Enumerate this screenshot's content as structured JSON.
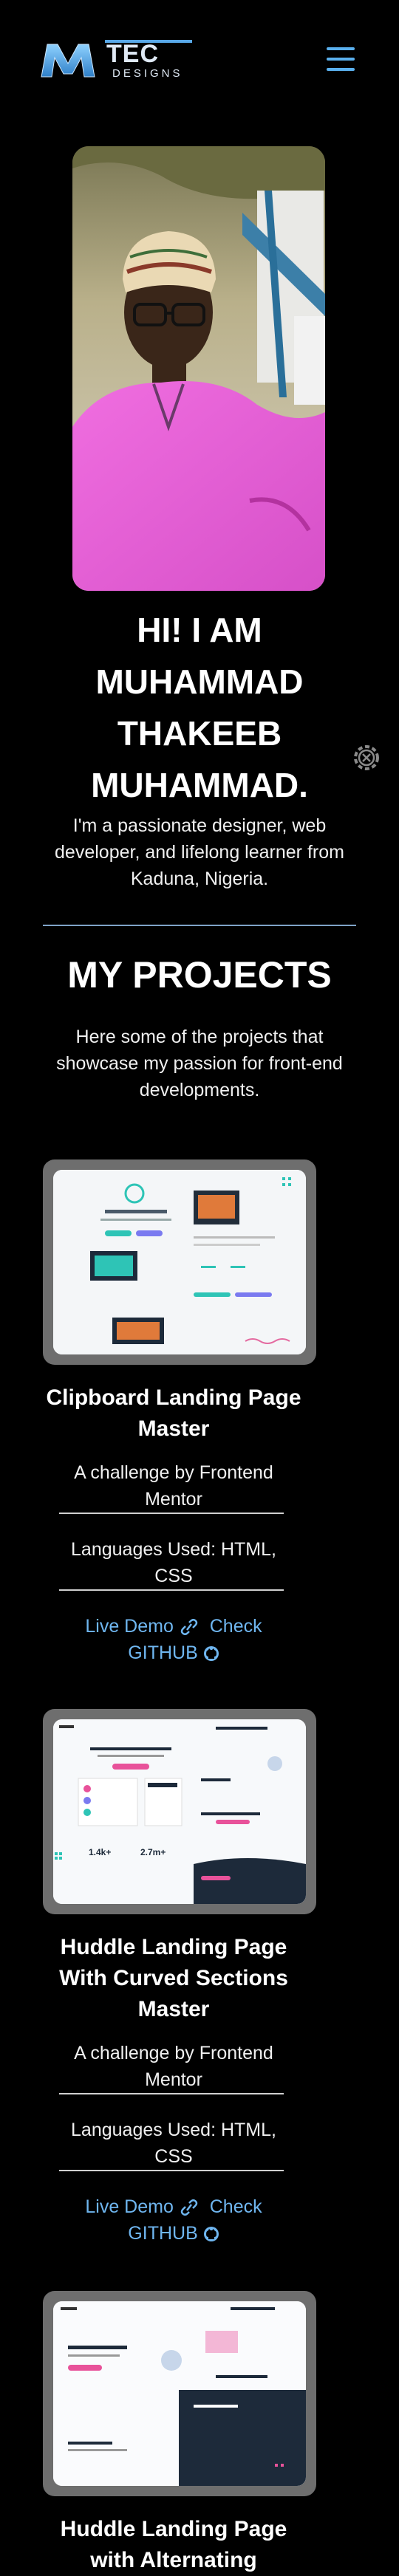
{
  "header": {
    "logo_main": "M",
    "logo_tec": "TEC",
    "logo_designs": "DESIGNS"
  },
  "hero": {
    "title_lines": [
      "HI! I AM",
      "MUHAMMAD",
      "THAKEEB",
      "MUHAMMAD."
    ],
    "bio": "I'm a passionate designer, web developer, and lifelong learner from Kaduna, Nigeria."
  },
  "projects_section": {
    "title": "MY PROJECTS",
    "subtitle": "Here some of the projects that showcase my passion for front-end developments."
  },
  "projects": [
    {
      "title": "Clipboard Landing Page Master",
      "desc": "A challenge by Frontend Mentor",
      "languages": "Languages Used: HTML, CSS",
      "live_demo": "Live Demo",
      "check_github": "Check GITHUB"
    },
    {
      "title": "Huddle Landing Page With Curved Sections Master",
      "desc": "A challenge by Frontend Mentor",
      "languages": "Languages Used: HTML, CSS",
      "live_demo": "Live Demo",
      "check_github": "Check GITHUB"
    },
    {
      "title": "Huddle Landing Page with Alternating"
    }
  ],
  "colors": {
    "accent": "#6fb6f0",
    "background": "#000000",
    "divider": "#7fa3c7"
  }
}
